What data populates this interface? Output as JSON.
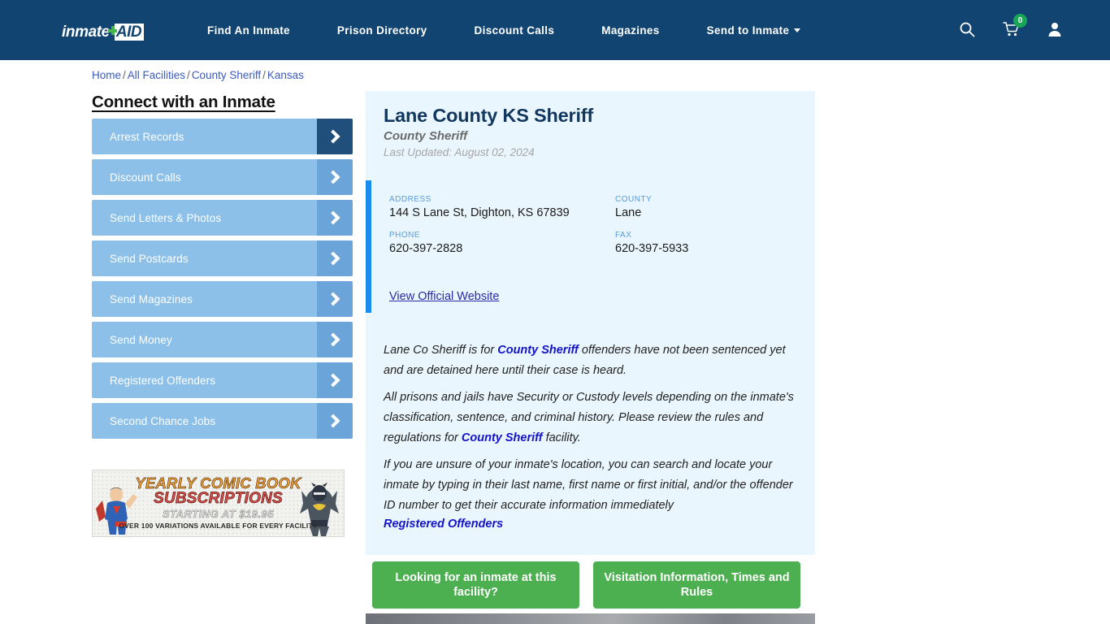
{
  "header": {
    "logo": {
      "word": "inmate",
      "aid": "AID",
      "plus_icon": "plus-icon",
      "plus_color": "#46b64b"
    },
    "background": "#114470",
    "nav": [
      {
        "label": "Find An Inmate"
      },
      {
        "label": "Prison Directory"
      },
      {
        "label": "Discount Calls"
      },
      {
        "label": "Magazines"
      },
      {
        "label": "Send to Inmate",
        "has_dropdown": true
      }
    ],
    "icons": {
      "search": "search-icon",
      "cart": "cart-icon",
      "account": "user-account-icon",
      "cart_count": "0",
      "cart_badge_color": "#18a558"
    }
  },
  "breadcrumb": {
    "items": [
      "Home",
      "All Facilities",
      "County Sheriff",
      "Kansas"
    ],
    "separator": "/",
    "link_color": "#3b5bbd"
  },
  "sidebar": {
    "title": "Connect with an Inmate",
    "items": [
      {
        "label": "Arrest Records",
        "active": true
      },
      {
        "label": "Discount Calls",
        "active": false
      },
      {
        "label": "Send Letters & Photos",
        "active": false
      },
      {
        "label": "Send Postcards",
        "active": false
      },
      {
        "label": "Send Magazines",
        "active": false
      },
      {
        "label": "Send Money",
        "active": false
      },
      {
        "label": "Registered Offenders",
        "active": false
      },
      {
        "label": "Second Chance Jobs",
        "active": false
      }
    ],
    "button_color": "#8cc0e8",
    "arrow_color": "#6ba4d8",
    "arrow_active_color": "#1f4f7a"
  },
  "ad": {
    "line1": "YEARLY COMIC BOOK",
    "line2": "SUBSCRIPTIONS",
    "line3": "STARTING AT $19.95",
    "line4": "OVER 100 VARIATIONS AVAILABLE FOR EVERY FACILITY"
  },
  "facility": {
    "title": "Lane County KS Sheriff",
    "subtitle": "County Sheriff",
    "last_updated": "Last Updated: August 02, 2024",
    "accent_color": "#1a8cf0",
    "card_background": "#eaf6fd",
    "fields": [
      {
        "label": "ADDRESS",
        "value": "144 S Lane St, Dighton, KS 67839"
      },
      {
        "label": "COUNTY",
        "value": "Lane"
      },
      {
        "label": "PHONE",
        "value": "620-397-2828"
      },
      {
        "label": "FAX",
        "value": "620-397-5933"
      }
    ],
    "official_website_link": "View Official Website"
  },
  "body": {
    "p1_a": "Lane Co Sheriff is for ",
    "p1_link": "County Sheriff",
    "p1_b": " offenders have not been sentenced yet and are detained here until their case is heard.",
    "p2_a": "All prisons and jails have Security or Custody levels depending on the inmate's classification, sentence, and criminal history. Please review the rules and regulations for ",
    "p2_link": "County Sheriff",
    "p2_b": " facility.",
    "p3": "If you are unsure of your inmate's location, you can search and locate your inmate by typing in their last name, first name or first initial, and/or the offender ID number to get their accurate information immediately",
    "p4_link": "Registered Offenders"
  },
  "cta": {
    "button1": "Looking for an inmate at this facility?",
    "button2": "Visitation Information, Times and Rules",
    "color": "#4caf50"
  }
}
